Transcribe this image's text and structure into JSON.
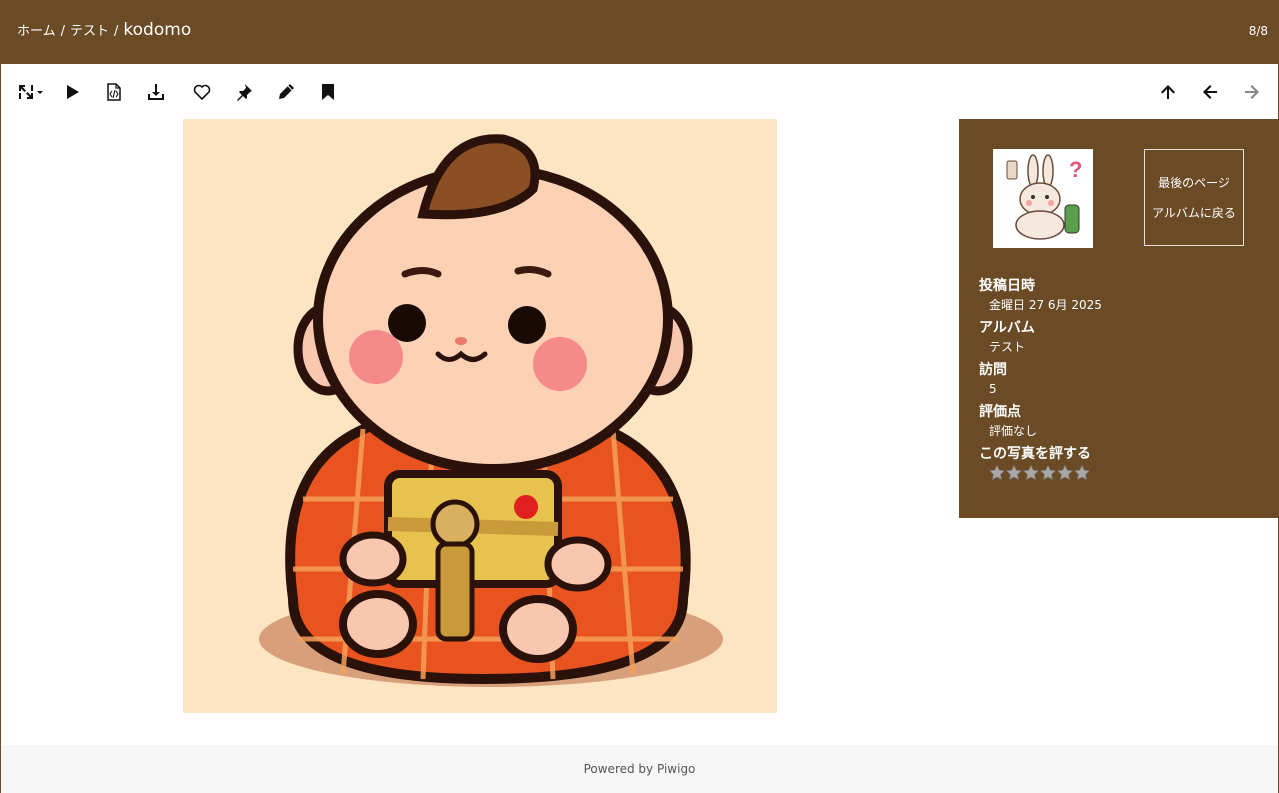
{
  "header": {
    "breadcrumb": [
      {
        "label": "ホーム"
      },
      {
        "label": "テスト"
      }
    ],
    "separator": "/",
    "current": "kodomo",
    "counter": "8/8"
  },
  "toolbar": {
    "left_icons": [
      "expand-size-icon",
      "play-slideshow-icon",
      "metadata-icon",
      "download-icon",
      "favorite-heart-icon",
      "pin-icon",
      "edit-pencil-icon",
      "bookmark-icon"
    ],
    "right_icons": [
      "up-arrow-icon",
      "previous-arrow-icon",
      "next-arrow-icon"
    ]
  },
  "info": {
    "nav": {
      "last_page": "最後のページ",
      "back_to_album": "アルバムに戻る"
    },
    "posted_label": "投稿日時",
    "posted_value": "金曜日 27 6月 2025",
    "album_label": "アルバム",
    "album_value": "テスト",
    "visits_label": "訪問",
    "visits_value": "5",
    "rating_label": "評価点",
    "rating_value": "評価なし",
    "rate_label": "この写真を評する",
    "stars_count": 6
  },
  "footer": {
    "powered_prefix": "Powered by",
    "powered_link": "Piwigo"
  },
  "colors": {
    "brand_brown": "#6b4a26",
    "photo_background": "#fde4c2",
    "kimono_orange": "#e8531f"
  }
}
